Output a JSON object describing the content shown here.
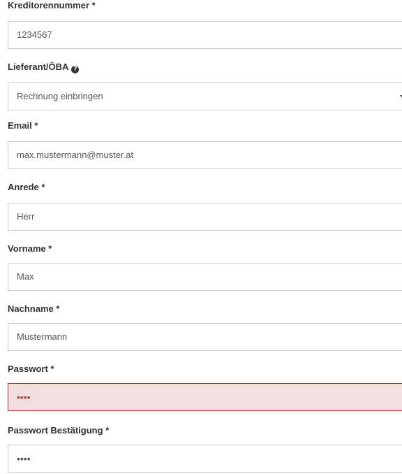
{
  "form": {
    "creditor_number": {
      "label": "Kreditorennummer *",
      "value": "1234567"
    },
    "supplier": {
      "label": "Lieferant/ÖBA",
      "help_icon": "question-circle-icon",
      "selected": "Rechnung einbringen"
    },
    "email": {
      "label": "Email *",
      "value": "max.mustermann@muster.at"
    },
    "salutation": {
      "label": "Anrede *",
      "value": "Herr"
    },
    "first_name": {
      "label": "Vorname *",
      "value": "Max"
    },
    "last_name": {
      "label": "Nachname *",
      "value": "Mustermann"
    },
    "password": {
      "label": "Passwort *",
      "value": "••••",
      "state": "error"
    },
    "password_confirm": {
      "label": "Passwort Bestätigung *",
      "value": "••••"
    }
  },
  "colors": {
    "border": "#cccccc",
    "error_border": "#c9302c",
    "error_background": "#f2dede",
    "error_text": "#a94442",
    "label_text": "#333333",
    "input_text": "#555555"
  }
}
